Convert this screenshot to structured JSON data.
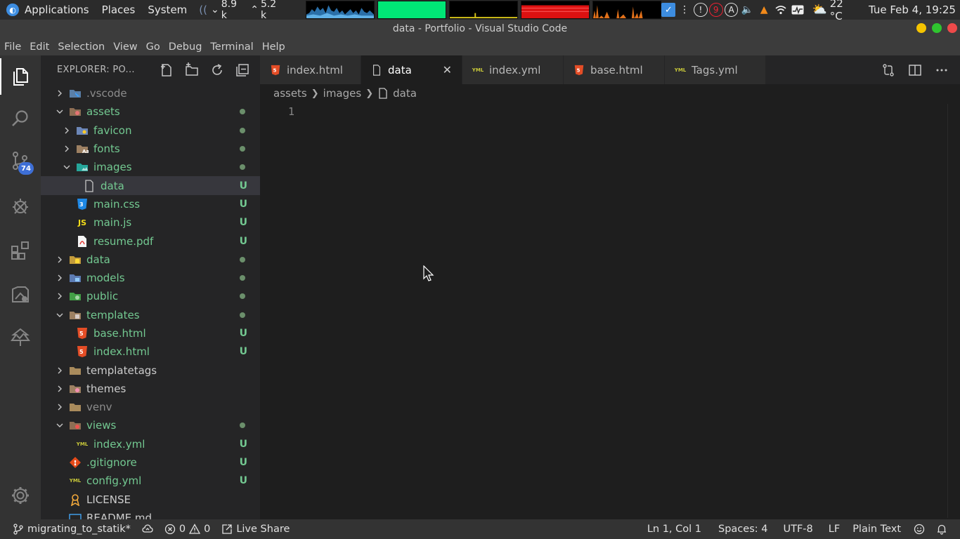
{
  "os_panel": {
    "menu": [
      "Applications",
      "Places",
      "System"
    ],
    "net_down": "8.9 k",
    "net_up": "5.2 k",
    "weather_temp": "22 °C",
    "clock": "Tue Feb  4, 19:25",
    "tray_badge": "9",
    "tray_letter": "A"
  },
  "window": {
    "title": "data - Portfolio - Visual Studio Code"
  },
  "menubar": [
    "File",
    "Edit",
    "Selection",
    "View",
    "Go",
    "Debug",
    "Terminal",
    "Help"
  ],
  "activitybar": {
    "scm_badge": "74"
  },
  "explorer": {
    "title": "EXPLORER: PO...",
    "items": [
      {
        "name": ".vscode",
        "type": "folder",
        "open": false,
        "level": 0,
        "icon": "vscode-folder-icon",
        "color": "dim",
        "status": ""
      },
      {
        "name": "assets",
        "type": "folder",
        "open": true,
        "level": 0,
        "icon": "assets-folder-icon",
        "color": "green",
        "status": "dot"
      },
      {
        "name": "favicon",
        "type": "folder",
        "open": false,
        "level": 1,
        "icon": "favicon-folder-icon",
        "color": "green",
        "status": "dot"
      },
      {
        "name": "fonts",
        "type": "folder",
        "open": false,
        "level": 1,
        "icon": "fonts-folder-icon",
        "color": "green",
        "status": "dot"
      },
      {
        "name": "images",
        "type": "folder",
        "open": true,
        "level": 1,
        "icon": "images-folder-icon",
        "color": "green",
        "status": "dot"
      },
      {
        "name": "data",
        "type": "file",
        "level": 2,
        "icon": "file-icon",
        "color": "green",
        "status": "U",
        "selected": true
      },
      {
        "name": "main.css",
        "type": "file",
        "level": 1,
        "icon": "css-file-icon",
        "color": "green",
        "status": "U"
      },
      {
        "name": "main.js",
        "type": "file",
        "level": 1,
        "icon": "js-file-icon",
        "color": "green",
        "status": "U"
      },
      {
        "name": "resume.pdf",
        "type": "file",
        "level": 1,
        "icon": "pdf-file-icon",
        "color": "green",
        "status": "U"
      },
      {
        "name": "data",
        "type": "folder",
        "open": false,
        "level": 0,
        "icon": "data-folder-icon",
        "color": "green",
        "status": "dot"
      },
      {
        "name": "models",
        "type": "folder",
        "open": false,
        "level": 0,
        "icon": "models-folder-icon",
        "color": "green",
        "status": "dot"
      },
      {
        "name": "public",
        "type": "folder",
        "open": false,
        "level": 0,
        "icon": "public-folder-icon",
        "color": "green",
        "status": "dot"
      },
      {
        "name": "templates",
        "type": "folder",
        "open": true,
        "level": 0,
        "icon": "templates-folder-icon",
        "color": "green",
        "status": "dot"
      },
      {
        "name": "base.html",
        "type": "file",
        "level": 1,
        "icon": "html-file-icon",
        "color": "green",
        "status": "U"
      },
      {
        "name": "index.html",
        "type": "file",
        "level": 1,
        "icon": "html-file-icon",
        "color": "green",
        "status": "U"
      },
      {
        "name": "templatetags",
        "type": "folder",
        "open": false,
        "level": 0,
        "icon": "folder-icon",
        "color": "plain",
        "status": ""
      },
      {
        "name": "themes",
        "type": "folder",
        "open": false,
        "level": 0,
        "icon": "themes-folder-icon",
        "color": "plain",
        "status": ""
      },
      {
        "name": "venv",
        "type": "folder",
        "open": false,
        "level": 0,
        "icon": "folder-icon",
        "color": "dim",
        "status": ""
      },
      {
        "name": "views",
        "type": "folder",
        "open": true,
        "level": 0,
        "icon": "views-folder-icon",
        "color": "green",
        "status": "dot"
      },
      {
        "name": "index.yml",
        "type": "file",
        "level": 1,
        "icon": "yml-file-icon",
        "color": "green",
        "status": "U"
      },
      {
        "name": ".gitignore",
        "type": "file",
        "level": 0,
        "icon": "git-file-icon",
        "color": "green",
        "status": "U"
      },
      {
        "name": "config.yml",
        "type": "file",
        "level": 0,
        "icon": "yml-file-icon",
        "color": "green",
        "status": "U"
      },
      {
        "name": "LICENSE",
        "type": "file",
        "level": 0,
        "icon": "license-file-icon",
        "color": "plain",
        "status": ""
      },
      {
        "name": "README.md",
        "type": "file",
        "level": 0,
        "icon": "md-file-icon",
        "color": "plain",
        "status": ""
      }
    ]
  },
  "tabs": [
    {
      "label": "index.html",
      "icon": "html-file-icon",
      "active": false
    },
    {
      "label": "data",
      "icon": "file-icon",
      "active": true
    },
    {
      "label": "index.yml",
      "icon": "yml-file-icon",
      "active": false
    },
    {
      "label": "base.html",
      "icon": "html-file-icon",
      "active": false
    },
    {
      "label": "Tags.yml",
      "icon": "yml-file-icon",
      "active": false
    }
  ],
  "breadcrumb": [
    "assets",
    "images",
    "data"
  ],
  "editor": {
    "line_numbers": [
      "1"
    ]
  },
  "statusbar": {
    "branch": "migrating_to_statik*",
    "errors": "0",
    "warnings": "0",
    "live_share": "Live Share",
    "position": "Ln 1, Col 1",
    "spaces": "Spaces: 4",
    "encoding": "UTF-8",
    "eol": "LF",
    "language": "Plain Text"
  },
  "colors": {
    "accent": "#3e6fd6",
    "git_untracked": "#73c991",
    "html_icon": "#e44d26",
    "css_icon": "#1e88e5",
    "js_icon": "#f5de19",
    "yml_icon": "#c9c93a"
  }
}
